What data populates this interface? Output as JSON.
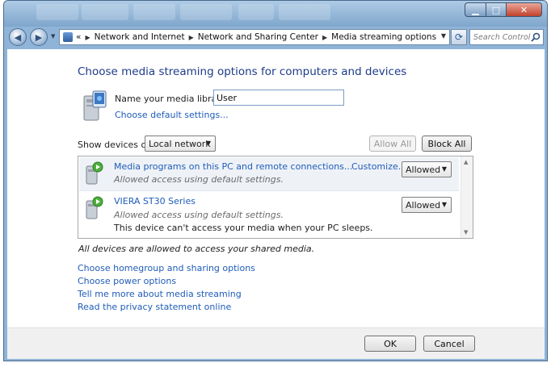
{
  "window": {
    "controls": {
      "minimize_icon": "minimize-icon",
      "maximize_icon": "maximize-icon",
      "close_icon": "close-icon"
    }
  },
  "address": {
    "overflow": "«",
    "breadcrumbs": [
      "Network and Internet",
      "Network and Sharing Center",
      "Media streaming options"
    ]
  },
  "search": {
    "placeholder": "Search Control P..."
  },
  "page": {
    "title": "Choose media streaming options for computers and devices",
    "library_label": "Name your media library:",
    "library_value": "User",
    "default_settings_link": "Choose default settings...",
    "show_devices_label": "Show devices on:",
    "show_devices_value": "Local network",
    "allow_all": "Allow All",
    "block_all": "Block All"
  },
  "devices": [
    {
      "name": "Media programs on this PC and remote connections...",
      "status": "Allowed access using default settings.",
      "customize": "Customize...",
      "permission": "Allowed"
    },
    {
      "name": "VIERA ST30 Series",
      "status": "Allowed access using default settings.",
      "note": "This device can't access your media when your PC sleeps.",
      "permission": "Allowed"
    }
  ],
  "all_devices_note": "All devices are allowed to access your shared media.",
  "links": [
    "Choose homegroup and sharing options",
    "Choose power options",
    "Tell me more about media streaming",
    "Read the privacy statement online"
  ],
  "footer": {
    "ok": "OK",
    "cancel": "Cancel"
  },
  "colors": {
    "link": "#1f5cb8",
    "title": "#1e3b8a",
    "frame": "#8fb4d8"
  }
}
